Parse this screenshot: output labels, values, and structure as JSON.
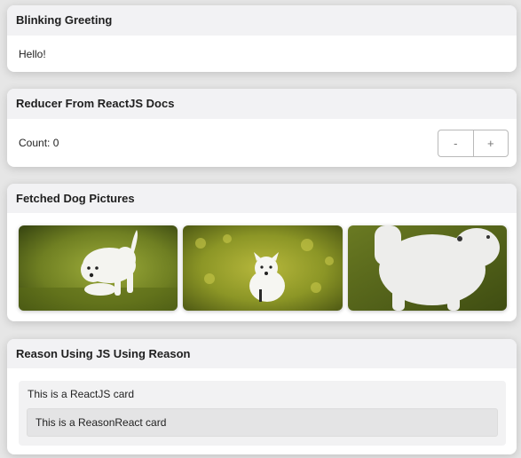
{
  "cards": [
    {
      "title": "Blinking Greeting",
      "body": "Hello!"
    },
    {
      "title": "Reducer From ReactJS Docs",
      "count_text": "Count: 0",
      "decrement_label": "-",
      "increment_label": "+"
    },
    {
      "title": "Fetched Dog Pictures"
    },
    {
      "title": "Reason Using JS Using Reason",
      "outer_text": "This is a ReactJS card",
      "inner_text": "This is a ReasonReact card"
    }
  ],
  "colors": {
    "page_background": "#e6e6e6",
    "card_header": "#f2f2f4",
    "card_body": "#ffffff",
    "inner_outer": "#f2f2f3",
    "inner_inner": "#e4e4e5"
  }
}
